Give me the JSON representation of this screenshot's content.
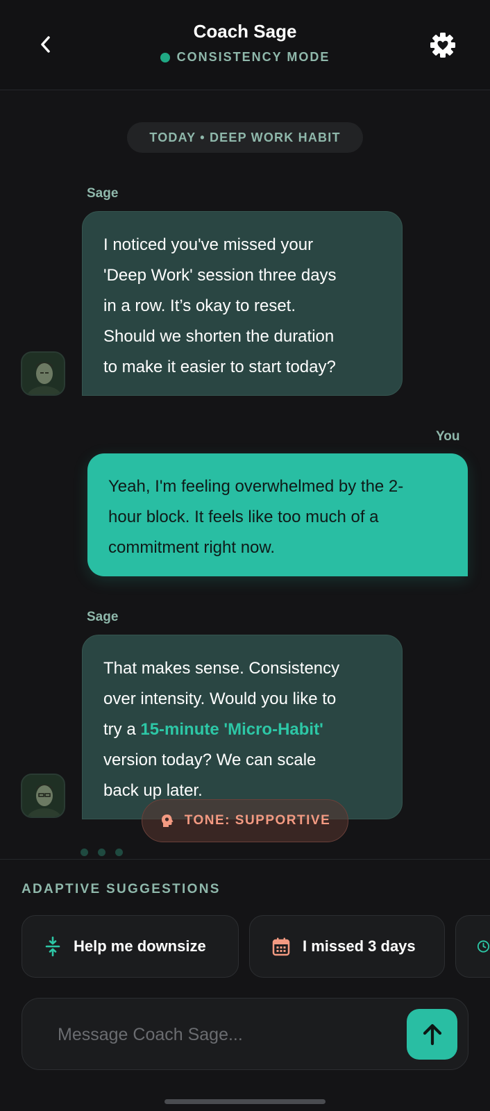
{
  "header": {
    "title": "Coach Sage",
    "mode_label": "CONSISTENCY MODE",
    "mode_color": "#20a884"
  },
  "date_pill": "TODAY • DEEP WORK HABIT",
  "messages": [
    {
      "sender": "Sage",
      "lines": [
        "I noticed you've missed your",
        "'Deep Work' session three days",
        "in a row. It’s okay to reset.",
        "Should we shorten the duration",
        "to make it easier to start today?"
      ]
    },
    {
      "sender": "You",
      "lines": [
        "Yeah, I'm feeling overwhelmed by the 2-",
        "hour block. It feels like too much of a",
        "commitment right now."
      ]
    },
    {
      "sender": "Sage",
      "line1": "That makes sense. Consistency",
      "line2": "over intensity. Would you like to",
      "line3_prefix": "try a ",
      "line3_highlight": "15-minute 'Micro-Habit'",
      "line4": "version today? We can scale",
      "line5": "back up later."
    }
  ],
  "tone_badge": "TONE: SUPPORTIVE",
  "suggestions": {
    "title": "ADAPTIVE SUGGESTIONS",
    "items": [
      {
        "label": "Help me downsize",
        "icon": "compress-icon"
      },
      {
        "label": "I missed 3 days",
        "icon": "calendar-icon"
      },
      {
        "label": "",
        "icon": "clock-icon"
      }
    ]
  },
  "composer": {
    "placeholder": "Message Coach Sage...",
    "value": ""
  },
  "colors": {
    "accent": "#29bea3",
    "coach_bubble": "#2a4643",
    "tone": "#f39a82",
    "muted_label": "#8fb8ab"
  }
}
